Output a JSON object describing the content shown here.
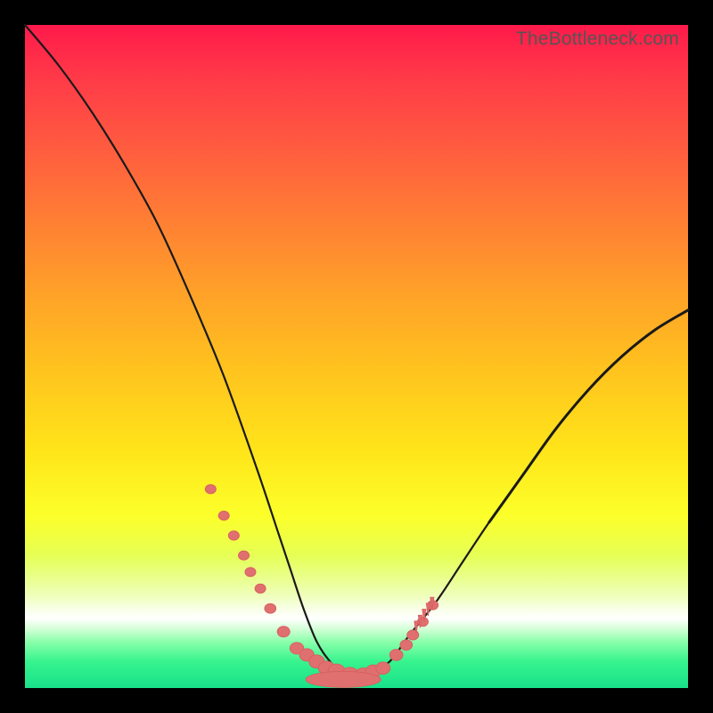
{
  "watermark": "TheBottleneck.com",
  "colors": {
    "frame": "#000000",
    "curve": "#1a1a1a",
    "marker": "#e07070",
    "gradient_top": "#ff1a4b",
    "gradient_bottom": "#18e18a"
  },
  "chart_data": {
    "type": "line",
    "title": "",
    "xlabel": "",
    "ylabel": "",
    "xlim": [
      0,
      100
    ],
    "ylim": [
      0,
      100
    ],
    "series": [
      {
        "name": "bottleneck-curve",
        "x": [
          0,
          5,
          10,
          15,
          20,
          25,
          30,
          35,
          38,
          40,
          42,
          44,
          46,
          48,
          50,
          52,
          55,
          58,
          62,
          66,
          70,
          75,
          80,
          85,
          90,
          95,
          100
        ],
        "y": [
          100,
          94,
          87,
          79,
          70,
          59,
          47,
          33,
          24,
          18,
          12,
          7,
          4,
          2,
          1,
          2,
          4,
          8,
          13,
          19,
          25,
          32,
          39,
          45,
          50,
          54,
          57
        ]
      }
    ],
    "markers": {
      "name": "highlight-points",
      "x": [
        28,
        30,
        31.5,
        33,
        34,
        35.5,
        37,
        39,
        41,
        42.5,
        44,
        45.5,
        47,
        49,
        51,
        52.5,
        54,
        56,
        57.5,
        58.5,
        60,
        61.5
      ],
      "y": [
        30,
        26,
        23,
        20,
        17.5,
        15,
        12,
        8.5,
        6,
        5,
        4,
        3,
        2.5,
        2,
        2,
        2.5,
        3,
        5,
        6.5,
        8,
        10,
        12.5
      ]
    }
  }
}
